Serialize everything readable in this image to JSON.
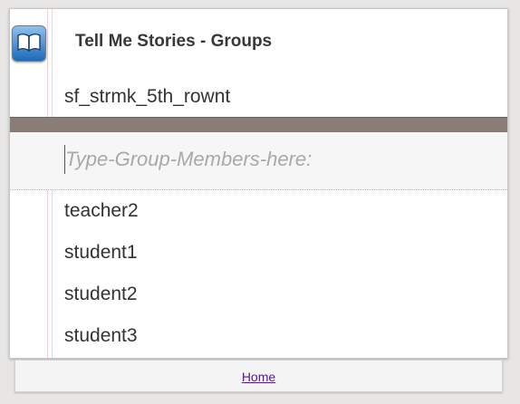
{
  "app": {
    "title": "Tell Me Stories - Groups",
    "icon": "open-book-icon"
  },
  "group": {
    "name": "sf_strmk_5th_rownt"
  },
  "members_input": {
    "value": "",
    "placeholder": "Type-Group-Members-here:"
  },
  "members": [
    "teacher2",
    "student1",
    "student2",
    "student3"
  ],
  "footer": {
    "home_label": "Home"
  },
  "colors": {
    "divider": "#8a7d77",
    "page_background": "#e8e6e4",
    "link": "#551a8b",
    "margin_line": "#f1cfd3"
  }
}
